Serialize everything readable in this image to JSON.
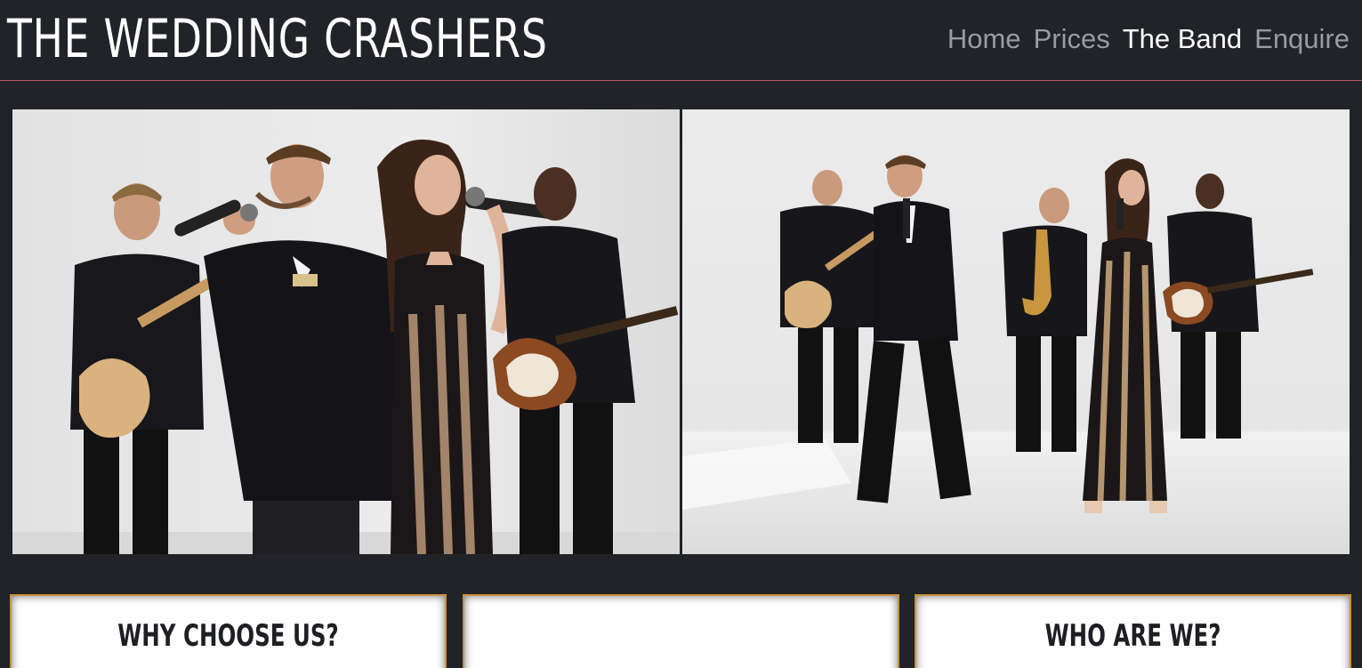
{
  "site": {
    "title": "THE WEDDING CRASHERS"
  },
  "nav": {
    "items": [
      {
        "label": "Home",
        "active": false
      },
      {
        "label": "Prices",
        "active": false
      },
      {
        "label": "The Band",
        "active": true
      },
      {
        "label": "Enquire",
        "active": false
      }
    ]
  },
  "gallery": {
    "photos": [
      {
        "subject": "band-closeup-singers-with-microphones"
      },
      {
        "subject": "band-full-lineup-with-guitars-and-saxophone"
      }
    ]
  },
  "cards": [
    {
      "heading": "WHY CHOOSE US?"
    },
    {
      "heading": ""
    },
    {
      "heading": "WHO ARE WE?"
    }
  ],
  "colors": {
    "background": "#212328",
    "header_rule": "#b45a63",
    "card_border": "#c8913a",
    "nav_inactive": "#9a9ba0",
    "nav_active": "#ffffff"
  }
}
